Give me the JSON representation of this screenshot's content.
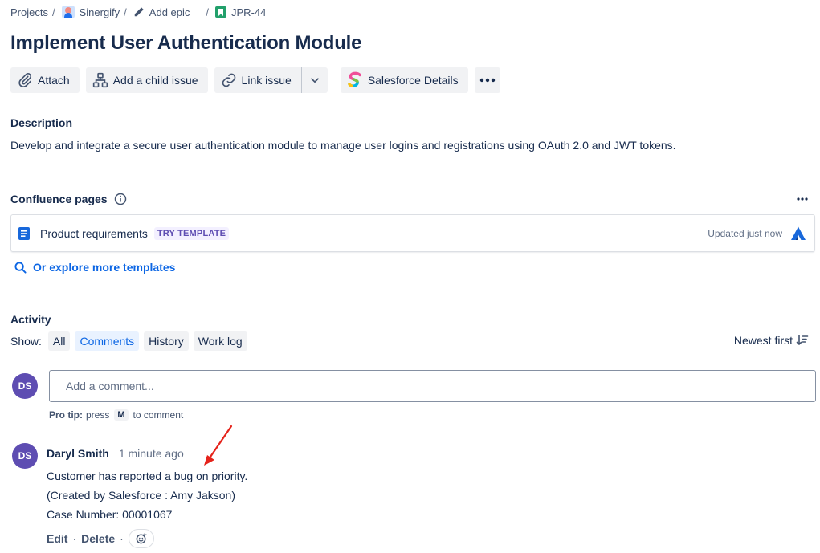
{
  "breadcrumb": {
    "projects": "Projects",
    "project": "Sinergify",
    "add_epic": "Add epic",
    "issue_key": "JPR-44",
    "separator": "/"
  },
  "issue": {
    "title": "Implement User Authentication Module"
  },
  "toolbar": {
    "attach": "Attach",
    "add_child": "Add a child issue",
    "link_issue": "Link issue",
    "salesforce": "Salesforce Details"
  },
  "description": {
    "heading": "Description",
    "text": "Develop and integrate a secure user authentication module to manage user logins and registrations using OAuth 2.0 and JWT tokens."
  },
  "confluence": {
    "heading": "Confluence pages",
    "page_name": "Product requirements",
    "lozenge": "TRY TEMPLATE",
    "updated": "Updated just now",
    "explore": "Or explore more templates"
  },
  "activity": {
    "heading": "Activity",
    "show_label": "Show:",
    "filters": [
      "All",
      "Comments",
      "History",
      "Work log"
    ],
    "active_filter": "Comments",
    "sort": "Newest first",
    "comment_placeholder": "Add a comment...",
    "tip_bold": "Pro tip:",
    "tip_press": "press",
    "tip_key": "M",
    "tip_rest": "to comment",
    "current_user_initials": "DS"
  },
  "comment": {
    "initials": "DS",
    "author": "Daryl Smith",
    "time": "1 minute ago",
    "lines": [
      "Customer has reported a bug on priority.",
      "(Created by Salesforce : Amy Jakson)",
      "Case Number: 00001067"
    ],
    "edit": "Edit",
    "delete": "Delete",
    "dot": "·"
  },
  "colors": {
    "brand_blue": "#0c66e4",
    "avatar_purple": "#5e4db2",
    "story_green": "#22a06b",
    "annotation_red": "#e5231b"
  },
  "icons": [
    "paperclip-icon",
    "hierarchy-icon",
    "link-icon",
    "chevron-down-icon",
    "salesforce-logo-icon",
    "more-icon",
    "info-icon",
    "document-icon",
    "atlassian-logo-icon",
    "search-icon",
    "sort-icon",
    "emoji-add-icon",
    "pencil-icon",
    "story-icon"
  ]
}
